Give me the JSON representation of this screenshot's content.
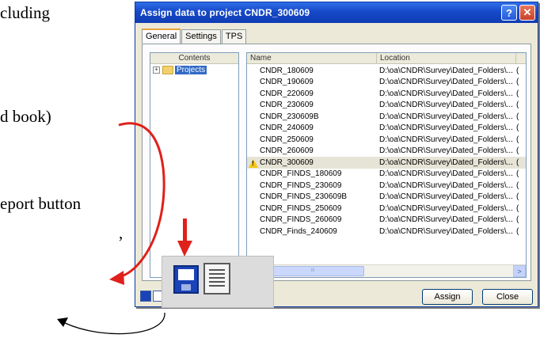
{
  "document_text": {
    "line1": "cluding",
    "line2": "d book)",
    "line3": "eport button",
    "line4": ","
  },
  "dialog": {
    "title": "Assign data to project CNDR_300609",
    "help_glyph": "?",
    "close_glyph": "✕",
    "tabs": [
      "General",
      "Settings",
      "TPS"
    ],
    "tree": {
      "header": "Contents",
      "expander": "+",
      "root_label": "Projects"
    },
    "list": {
      "columns": [
        "Name",
        "Location"
      ],
      "rows": [
        {
          "name": "CNDR_180609",
          "location": "D:\\oa\\CNDR\\Survey\\Dated_Folders\\...",
          "extra": "("
        },
        {
          "name": "CNDR_190609",
          "location": "D:\\oa\\CNDR\\Survey\\Dated_Folders\\...",
          "extra": "("
        },
        {
          "name": "CNDR_220609",
          "location": "D:\\oa\\CNDR\\Survey\\Dated_Folders\\...",
          "extra": "("
        },
        {
          "name": "CNDR_230609",
          "location": "D:\\oa\\CNDR\\Survey\\Dated_Folders\\...",
          "extra": "("
        },
        {
          "name": "CNDR_230609B",
          "location": "D:\\oa\\CNDR\\Survey\\Dated_Folders\\...",
          "extra": "("
        },
        {
          "name": "CNDR_240609",
          "location": "D:\\oa\\CNDR\\Survey\\Dated_Folders\\...",
          "extra": "("
        },
        {
          "name": "CNDR_250609",
          "location": "D:\\oa\\CNDR\\Survey\\Dated_Folders\\...",
          "extra": "("
        },
        {
          "name": "CNDR_260609",
          "location": "D:\\oa\\CNDR\\Survey\\Dated_Folders\\...",
          "extra": "("
        },
        {
          "name": "CNDR_300609",
          "location": "D:\\oa\\CNDR\\Survey\\Dated_Folders\\...",
          "extra": "(",
          "selected": true,
          "warning": true
        },
        {
          "name": "CNDR_FINDS_180609",
          "location": "D:\\oa\\CNDR\\Survey\\Dated_Folders\\...",
          "extra": "("
        },
        {
          "name": "CNDR_FINDS_230609",
          "location": "D:\\oa\\CNDR\\Survey\\Dated_Folders\\...",
          "extra": "("
        },
        {
          "name": "CNDR_FINDS_230609B",
          "location": "D:\\oa\\CNDR\\Survey\\Dated_Folders\\...",
          "extra": "("
        },
        {
          "name": "CNDR_FINDS_250609",
          "location": "D:\\oa\\CNDR\\Survey\\Dated_Folders\\...",
          "extra": "("
        },
        {
          "name": "CNDR_FINDS_260609",
          "location": "D:\\oa\\CNDR\\Survey\\Dated_Folders\\...",
          "extra": "("
        },
        {
          "name": "CNDR_Finds_240609",
          "location": "D:\\oa\\CNDR\\Survey\\Dated_Folders\\...",
          "extra": "("
        }
      ],
      "scroll_left": "<",
      "scroll_right": ">",
      "scroll_grip": "III"
    },
    "buttons": {
      "assign": "Assign",
      "close": "Close"
    }
  },
  "icons": {
    "save": "floppy-disk",
    "report": "report-document"
  },
  "colors": {
    "titlebar": "#1649c8",
    "annotation_arrow": "#e0201a",
    "selection": "#316ac5"
  }
}
